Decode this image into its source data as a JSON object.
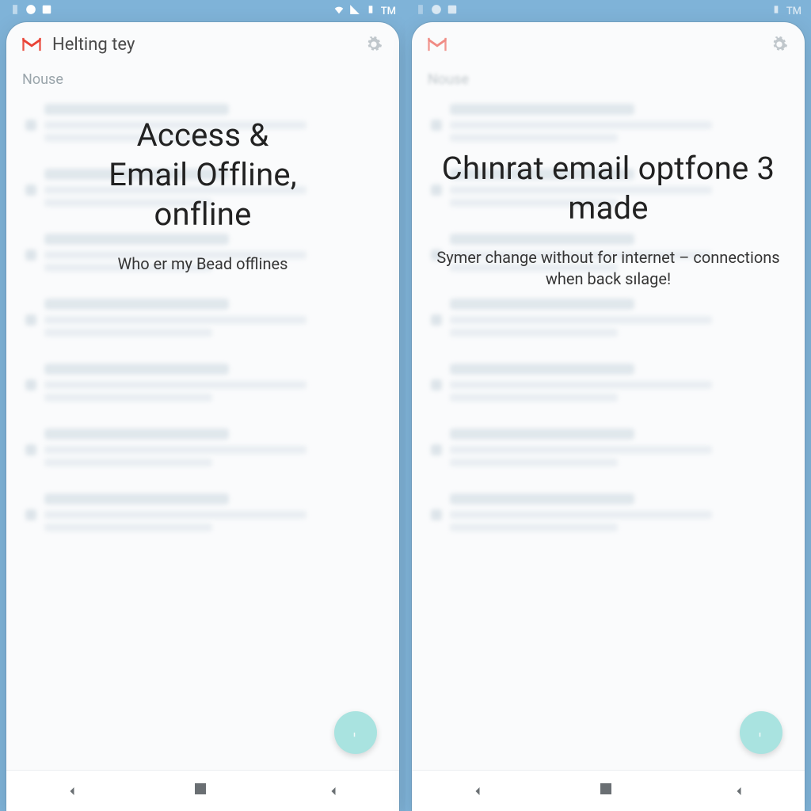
{
  "statusbar": {
    "tm_text": "TM",
    "tm_text_r": "TM"
  },
  "panels": [
    {
      "app_title": "Helting tey",
      "section": "Nouse",
      "overlay_title": "Access &\nEmail Offline,\nonfline",
      "overlay_sub": "Who er my Bead offlines",
      "fab_glyph": "F"
    },
    {
      "app_title": "",
      "section": "Nouse",
      "overlay_title": "Chınrat email optfone 3 made",
      "overlay_sub": "Symer change without for internet – connections when back sılage!",
      "fab_glyph": "F"
    }
  ],
  "icons": {
    "gmail": "gmail-icon",
    "gear": "gear-icon",
    "wifi": "wifi-icon",
    "signal": "signal-icon",
    "battery": "battery-icon",
    "plus": "plus-icon",
    "back": "chevron-left-icon",
    "home": "square-icon",
    "recents": "chevron-left-icon"
  },
  "colors": {
    "statusbar_bg": "#7fb3d8",
    "card_bg": "#fafbfc",
    "fab_bg": "#a9e3e0",
    "text_primary": "#222222",
    "text_muted": "#9aa5ab"
  }
}
